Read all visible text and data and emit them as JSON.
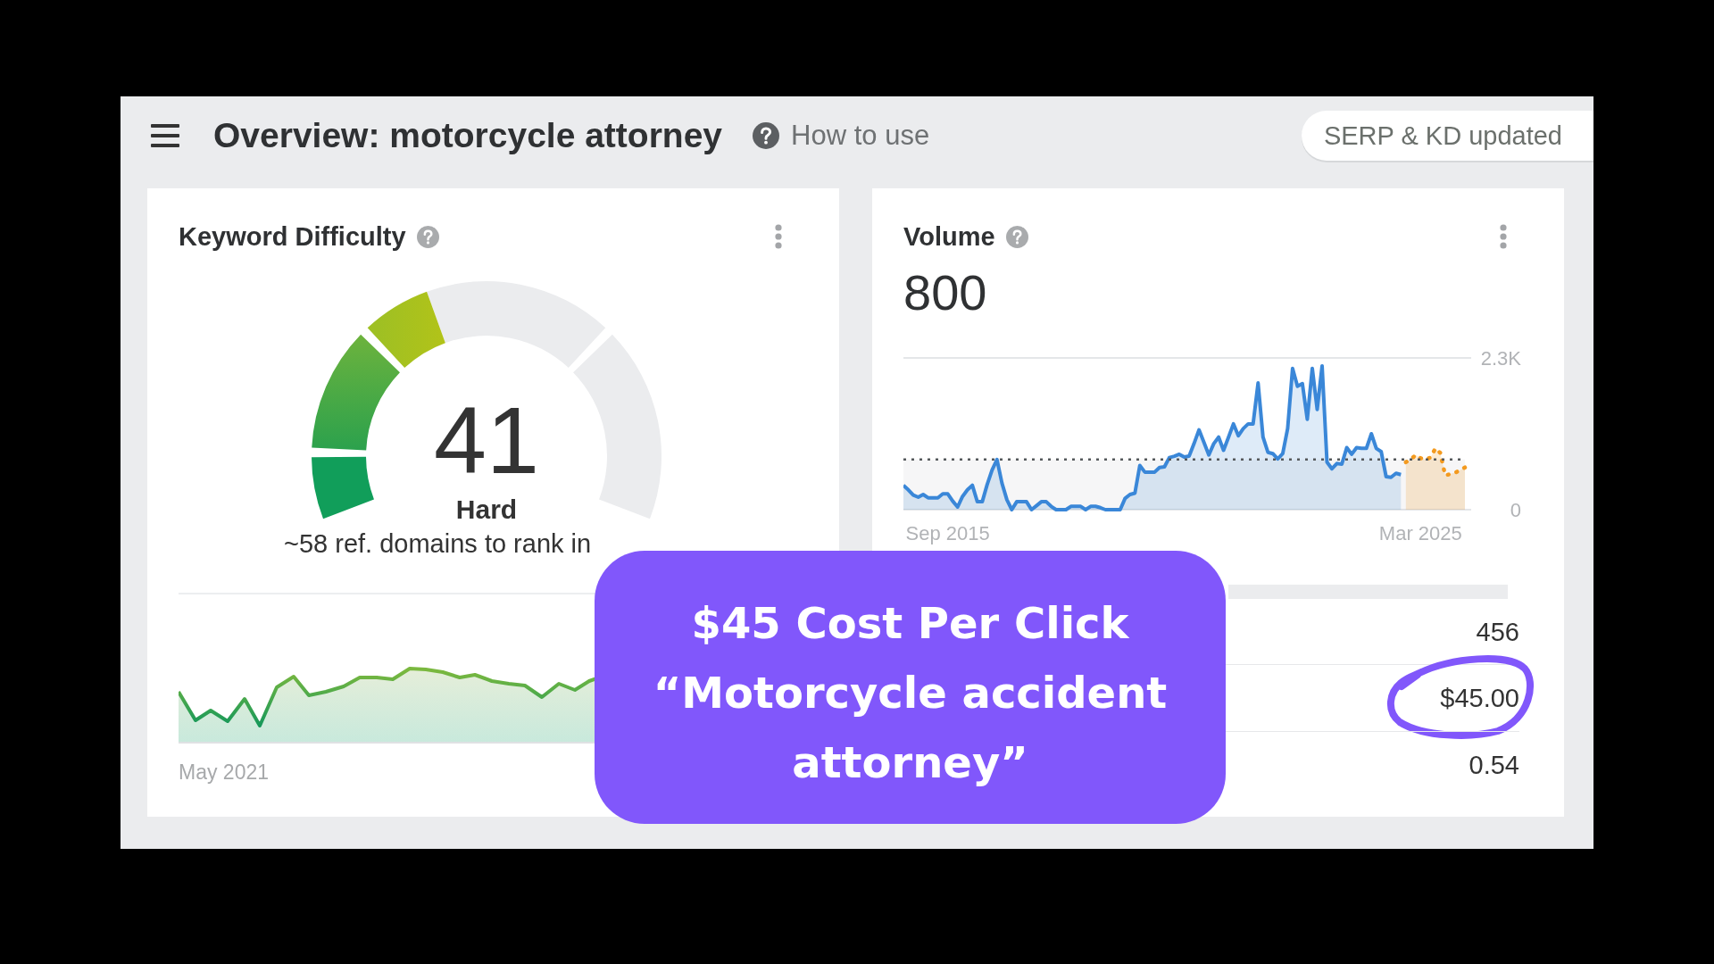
{
  "header": {
    "title": "Overview: motorcycle attorney",
    "help_link": "How to use",
    "status": "SERP & KD updated"
  },
  "cards": [
    {
      "kind": "difficulty",
      "title": "Keyword Difficulty",
      "score": "41",
      "level": 0.41,
      "rating": "Hard",
      "note": "~58 ref. domains to rank in",
      "trend": {
        "start_label": "May 2021"
      }
    },
    {
      "kind": "volume",
      "title": "Volume",
      "value": "800",
      "chart_data": {
        "type": "area",
        "categories": [
          null,
          null,
          null,
          null,
          null,
          null,
          null,
          null,
          null,
          "Sep 2015",
          null,
          null,
          null,
          null,
          null,
          null,
          null,
          null,
          null,
          null,
          null,
          null,
          null,
          null,
          null,
          null,
          null,
          null,
          null,
          null,
          null,
          null,
          null,
          null,
          null,
          null,
          null,
          null,
          null,
          null,
          null,
          null,
          null,
          null,
          null,
          null,
          null,
          null,
          null,
          null,
          null,
          null,
          null,
          null,
          null,
          null,
          null,
          null,
          null,
          null,
          null,
          null,
          null,
          null,
          null,
          null,
          null,
          null,
          null,
          null,
          null,
          null,
          null,
          null,
          null,
          null,
          null,
          null,
          null,
          null,
          null,
          null,
          null,
          null,
          null,
          null,
          null,
          null,
          null,
          null,
          null,
          null,
          null,
          null,
          null,
          null,
          null,
          null,
          null,
          null,
          null,
          null,
          null,
          null,
          null,
          "Mar 2025",
          null,
          null,
          null,
          null,
          null,
          null,
          null,
          null,
          null
        ],
        "series": [
          {
            "color": "#3a87d8",
            "values": [
              370,
              300,
              220,
              190,
              230,
              180,
              180,
              180,
              240,
              240,
              130,
              40,
              200,
              300,
              370,
              120,
              120,
              380,
              600,
              760,
              400,
              150,
              0,
              120,
              120,
              120,
              0,
              60,
              120,
              120,
              50,
              0,
              0,
              0,
              50,
              50,
              50,
              0,
              50,
              50,
              30,
              0,
              0,
              0,
              0,
              170,
              230,
              250,
              670,
              570,
              570,
              570,
              640,
              650,
              790,
              810,
              840,
              800,
              810,
              1000,
              1210,
              1020,
              830,
              1000,
              1100,
              900,
              1100,
              1300,
              1120,
              1230,
              1300,
              1300,
              1920,
              1100,
              870,
              850,
              770,
              850,
              1230,
              2140,
              1870,
              1910,
              1370,
              2140,
              1520,
              2180,
              720,
              620,
              700,
              690,
              940,
              840,
              940,
              930,
              930,
              1150,
              930,
              880,
              500,
              490,
              550,
              530,
              null,
              null,
              null,
              null,
              null,
              null,
              null,
              null,
              null,
              null,
              null,
              null,
              null
            ]
          },
          {
            "color": "#f39a1f",
            "values": [
              null,
              null,
              null,
              null,
              null,
              null,
              null,
              null,
              null,
              null,
              null,
              null,
              null,
              null,
              null,
              null,
              null,
              null,
              null,
              null,
              null,
              null,
              null,
              null,
              null,
              null,
              null,
              null,
              null,
              null,
              null,
              null,
              null,
              null,
              null,
              null,
              null,
              null,
              null,
              null,
              null,
              null,
              null,
              null,
              null,
              null,
              null,
              null,
              null,
              null,
              null,
              null,
              null,
              null,
              null,
              null,
              null,
              null,
              null,
              null,
              null,
              null,
              null,
              null,
              null,
              null,
              null,
              null,
              null,
              null,
              null,
              null,
              null,
              null,
              null,
              null,
              null,
              null,
              null,
              null,
              null,
              null,
              null,
              null,
              null,
              null,
              null,
              null,
              null,
              null,
              null,
              null,
              null,
              null,
              null,
              null,
              null,
              null,
              null,
              null,
              null,
              null,
              720,
              760,
              830,
              780,
              760,
              790,
              930,
              860,
              520,
              540,
              560,
              600,
              640
            ]
          },
          {
            "color": "#55585b",
            "values": [
              760,
              760,
              760,
              760,
              760,
              760,
              760,
              760,
              760,
              760,
              760,
              760,
              760,
              760,
              760,
              760,
              760,
              760,
              760,
              760,
              760,
              760,
              760,
              760,
              760,
              760,
              760,
              760,
              760,
              760,
              760,
              760,
              760,
              760,
              760,
              760,
              760,
              760,
              760,
              760,
              760,
              760,
              760,
              760,
              760,
              760,
              760,
              760,
              760,
              760,
              760,
              760,
              760,
              760,
              760,
              760,
              760,
              760,
              760,
              760,
              760,
              760,
              760,
              760,
              760,
              760,
              760,
              760,
              760,
              760,
              760,
              760,
              760,
              760,
              760,
              760,
              760,
              760,
              760,
              760,
              760,
              760,
              760,
              760,
              760,
              760,
              760,
              760,
              760,
              760,
              760,
              760,
              760,
              760,
              760,
              760,
              760,
              760,
              760,
              760,
              760,
              760,
              760,
              760,
              760,
              760,
              760,
              760,
              760,
              760,
              760,
              760,
              760,
              760,
              760
            ]
          }
        ],
        "ylim": [
          0,
          2300
        ],
        "yticks": [
          {
            "value": 0,
            "label": "0"
          },
          {
            "value": 2300,
            "label": "2.3K"
          }
        ]
      },
      "metrics": [
        {
          "value": "456",
          "circled": false
        },
        {
          "value": "$45.00",
          "circled": true
        },
        {
          "value": "0.54",
          "circled": false
        }
      ]
    }
  ],
  "callout": {
    "title": "$45 Cost Per Click",
    "text": "“Motorcycle accident attorney”"
  }
}
